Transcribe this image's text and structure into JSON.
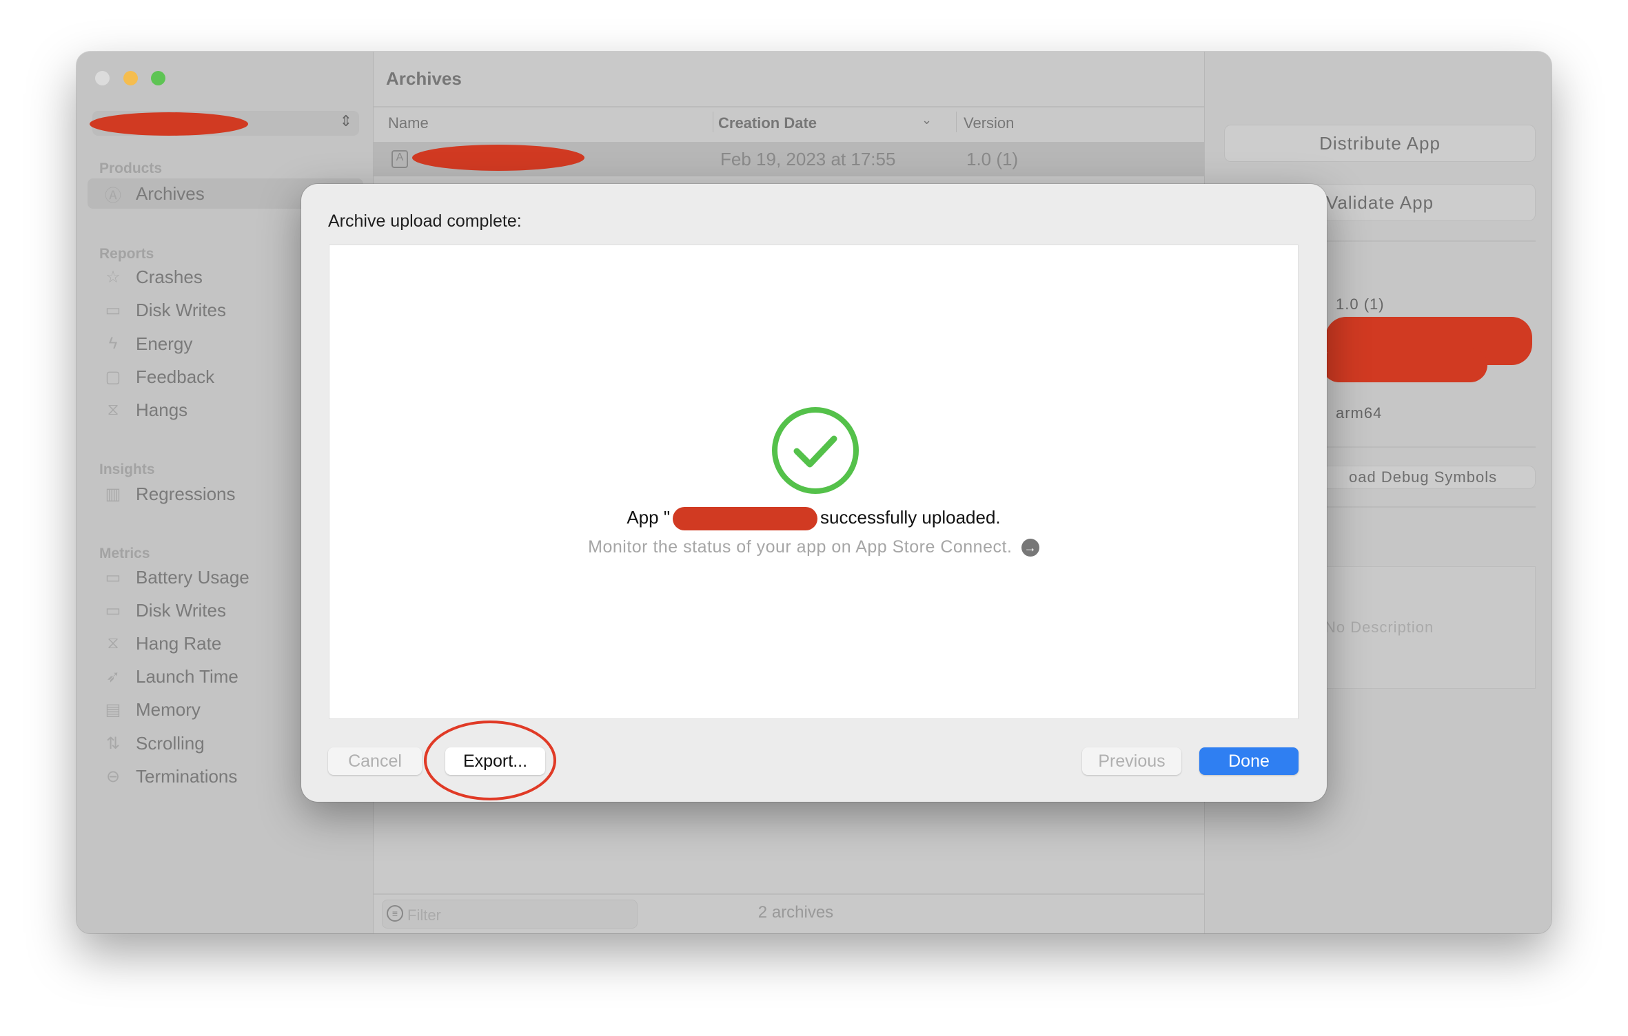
{
  "sidebar": {
    "sections": [
      {
        "label": "Products",
        "items": [
          {
            "label": "Archives",
            "icon": "app-store-icon"
          }
        ]
      },
      {
        "label": "Reports",
        "items": [
          {
            "label": "Crashes",
            "icon": "crash-star-icon"
          },
          {
            "label": "Disk Writes",
            "icon": "disk-icon"
          },
          {
            "label": "Energy",
            "icon": "bolt-icon"
          },
          {
            "label": "Feedback",
            "icon": "speech-bubble-icon"
          },
          {
            "label": "Hangs",
            "icon": "hourglass-icon"
          }
        ]
      },
      {
        "label": "Insights",
        "items": [
          {
            "label": "Regressions",
            "icon": "bar-chart-icon"
          }
        ]
      },
      {
        "label": "Metrics",
        "items": [
          {
            "label": "Battery Usage",
            "icon": "battery-icon"
          },
          {
            "label": "Disk Writes",
            "icon": "disk-icon"
          },
          {
            "label": "Hang Rate",
            "icon": "hourglass-icon"
          },
          {
            "label": "Launch Time",
            "icon": "rocket-icon"
          },
          {
            "label": "Memory",
            "icon": "memory-chip-icon"
          },
          {
            "label": "Scrolling",
            "icon": "scroll-icon"
          },
          {
            "label": "Terminations",
            "icon": "minus-circle-icon"
          }
        ]
      }
    ]
  },
  "archives": {
    "title": "Archives",
    "columns": [
      "Name",
      "Creation Date",
      "Version"
    ],
    "rows": [
      {
        "date": "Feb 19, 2023 at 17:55",
        "version": "1.0 (1)"
      }
    ],
    "filter_placeholder": "Filter",
    "count": "2 archives"
  },
  "details": {
    "distribute": "Distribute App",
    "validate": "Validate App",
    "version": "1.0 (1)",
    "arch": "arm64",
    "debug_symbols": "oad Debug Symbols",
    "description": "No Description"
  },
  "dialog": {
    "title": "Archive upload complete:",
    "message_prefix": "App \"",
    "message_suffix": "successfully uploaded.",
    "monitor": "Monitor the status of your app on App Store Connect.",
    "cancel": "Cancel",
    "export": "Export...",
    "previous": "Previous",
    "done": "Done"
  },
  "colors": {
    "accent": "#2f7ff2",
    "success": "#54c14a",
    "annotation": "#e03a26"
  }
}
